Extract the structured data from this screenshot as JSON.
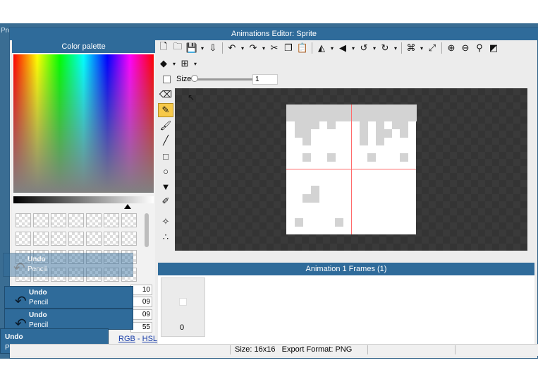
{
  "background": {
    "left_text": "Pre"
  },
  "window": {
    "title": "Animations Editor: Sprite"
  },
  "palette": {
    "header": "Color palette",
    "spectrum_colors": [
      "#ff0000",
      "#ffff00",
      "#00ff00",
      "#00ffff",
      "#0000ff",
      "#ff00ff"
    ],
    "fields": [
      "10",
      "09",
      "09",
      "55"
    ],
    "rgb_label": "RGB",
    "separator": " - ",
    "hsl_label": "HSL"
  },
  "toasts": [
    {
      "title": "Undo",
      "subtitle": "Pencil"
    },
    {
      "title": "Undo",
      "subtitle": "Pencil"
    },
    {
      "title": "Undo",
      "subtitle": "Pencil"
    },
    {
      "title": "Undo",
      "subtitle": "Pencil"
    }
  ],
  "toolbar": {
    "icons": [
      "new-file",
      "open-folder",
      "save",
      "export",
      "undo",
      "redo",
      "cut",
      "copy",
      "paste",
      "flip-horizontal",
      "flip-vertical",
      "rotate-left",
      "rotate-right",
      "crop",
      "resize",
      "zoom-in",
      "zoom-out",
      "zoom-fit",
      "fullscreen",
      "layers",
      "grid"
    ]
  },
  "size": {
    "label": "Size",
    "value": "1",
    "slider_fraction": 0.0
  },
  "tools": {
    "icons": [
      "eraser",
      "pencil",
      "brush",
      "line",
      "rectangle",
      "ellipse",
      "fill-bucket",
      "color-picker",
      "wand",
      "nodes"
    ],
    "active": "pencil"
  },
  "sprite": {
    "grid_size": 16,
    "pixel_color": "#d3d3d3",
    "guide_color": "#ff6b6b",
    "pixels": [
      [
        0,
        0
      ],
      [
        1,
        0
      ],
      [
        2,
        0
      ],
      [
        3,
        0
      ],
      [
        4,
        0
      ],
      [
        5,
        0
      ],
      [
        6,
        0
      ],
      [
        7,
        0
      ],
      [
        8,
        0
      ],
      [
        9,
        0
      ],
      [
        10,
        0
      ],
      [
        11,
        0
      ],
      [
        12,
        0
      ],
      [
        13,
        0
      ],
      [
        14,
        0
      ],
      [
        15,
        0
      ],
      [
        0,
        1
      ],
      [
        1,
        1
      ],
      [
        2,
        1
      ],
      [
        3,
        1
      ],
      [
        4,
        1
      ],
      [
        5,
        1
      ],
      [
        6,
        1
      ],
      [
        7,
        1
      ],
      [
        8,
        1
      ],
      [
        9,
        1
      ],
      [
        10,
        1
      ],
      [
        11,
        1
      ],
      [
        12,
        1
      ],
      [
        13,
        1
      ],
      [
        14,
        1
      ],
      [
        15,
        1
      ],
      [
        1,
        2
      ],
      [
        2,
        2
      ],
      [
        3,
        2
      ],
      [
        5,
        2
      ],
      [
        9,
        2
      ],
      [
        11,
        2
      ],
      [
        13,
        2
      ],
      [
        14,
        2
      ],
      [
        1,
        3
      ],
      [
        2,
        3
      ],
      [
        9,
        3
      ],
      [
        11,
        3
      ],
      [
        12,
        3
      ],
      [
        14,
        3
      ],
      [
        2,
        4
      ],
      [
        9,
        4
      ],
      [
        11,
        4
      ],
      [
        2,
        6
      ],
      [
        5,
        6
      ],
      [
        10,
        6
      ],
      [
        14,
        6
      ],
      [
        3,
        10
      ],
      [
        2,
        11
      ],
      [
        3,
        11
      ],
      [
        1,
        14
      ],
      [
        6,
        14
      ]
    ]
  },
  "frames": {
    "header": "Animation 1 Frames (1)",
    "frame_index": "0"
  },
  "status": {
    "size_text": "Size: 16x16",
    "export_text": "Export Format: PNG"
  }
}
